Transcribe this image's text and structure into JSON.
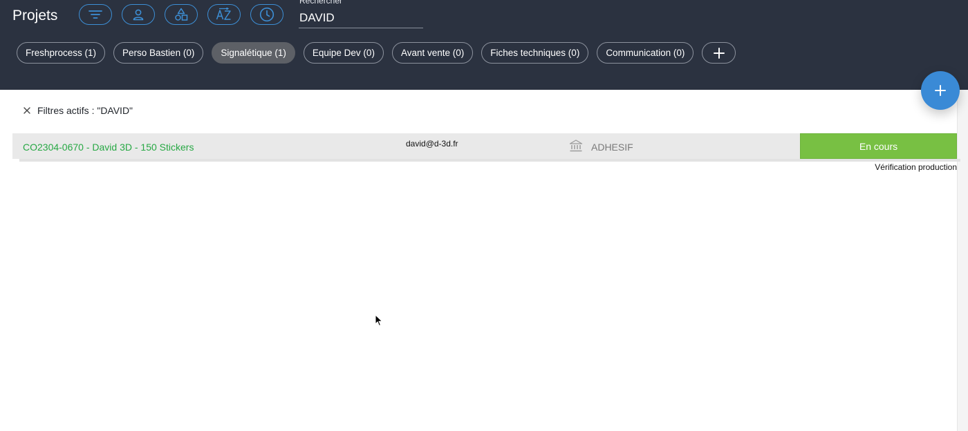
{
  "header": {
    "title": "Projets",
    "toolbar": {
      "filter_icon": "filter-icon",
      "user_icon": "user-icon",
      "shapes_icon": "shapes-icon",
      "sort_icon": "sort-az-icon",
      "history_icon": "clock-icon"
    },
    "search": {
      "label": "Rechercher",
      "value": "DAVID"
    },
    "chips": [
      {
        "label": "Freshprocess (1)",
        "active": false
      },
      {
        "label": "Perso Bastien (0)",
        "active": false
      },
      {
        "label": "Signalétique (1)",
        "active": true
      },
      {
        "label": "Equipe Dev (0)",
        "active": false
      },
      {
        "label": "Avant vente (0)",
        "active": false
      },
      {
        "label": "Fiches techniques (0)",
        "active": false
      },
      {
        "label": "Communication (0)",
        "active": false
      }
    ],
    "add_chip_icon": "plus-icon"
  },
  "fab_icon": "plus-icon",
  "filters": {
    "text": "Filtres actifs : \"DAVID\"",
    "clear_icon": "close-icon"
  },
  "results": [
    {
      "reference": "CO2304-0670 - David 3D - 150 Stickers",
      "email": "david@d-3d.fr",
      "type_icon": "bank-icon",
      "type": "ADHESIF",
      "status": "En cours",
      "substatus": "Vérification production"
    }
  ],
  "colors": {
    "header_bg": "#2b3240",
    "accent_blue": "#3a8ad6",
    "link_green": "#27a844",
    "status_green": "#78c043",
    "row_bg": "#e9e9e9"
  }
}
